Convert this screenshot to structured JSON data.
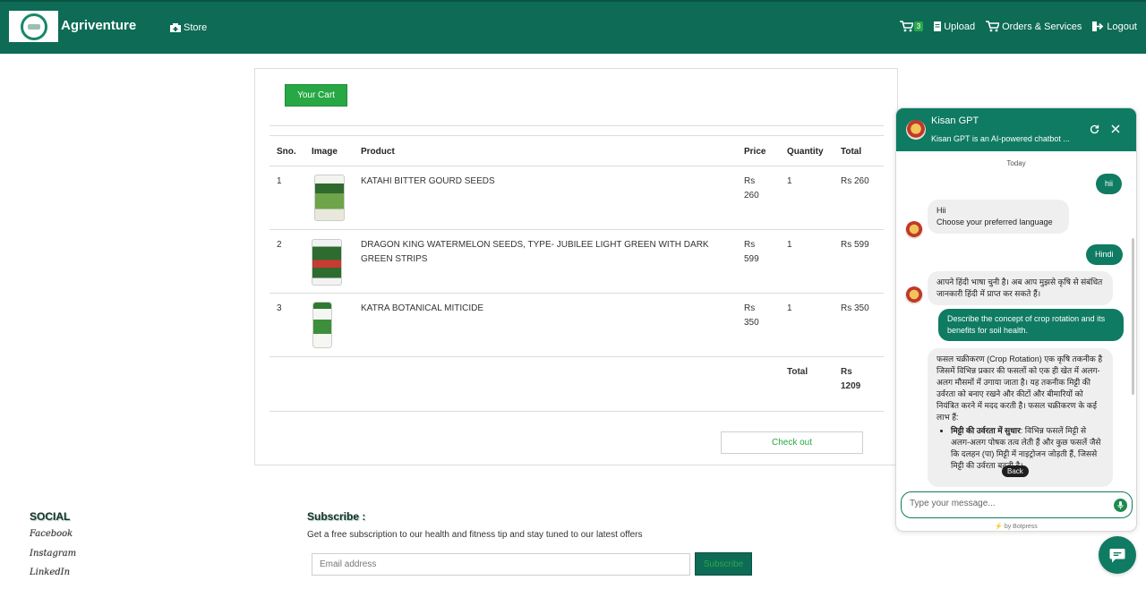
{
  "navbar": {
    "brand": "Agriventure",
    "store": "Store",
    "cart_count": "3",
    "upload": "Upload",
    "orders": "Orders & Services",
    "logout": "Logout"
  },
  "cart": {
    "title": "Your Cart",
    "headers": {
      "sno": "Sno.",
      "image": "Image",
      "product": "Product",
      "price": "Price",
      "quantity": "Quantity",
      "total": "Total"
    },
    "rows": [
      {
        "sno": "1",
        "product_line1": "KATAHI BITTER GOURD SEEDS",
        "product_line2": "",
        "price_line1": "Rs",
        "price_line2": "260",
        "quantity": "1",
        "total": "Rs 260"
      },
      {
        "sno": "2",
        "product_line1": "DRAGON KING WATERMELON SEEDS, TYPE- JUBILEE LIGHT GREEN WITH DARK",
        "product_line2": "GREEN STRIPS",
        "price_line1": "Rs",
        "price_line2": "599",
        "quantity": "1",
        "total": "Rs 599"
      },
      {
        "sno": "3",
        "product_line1": "KATRA BOTANICAL MITICIDE",
        "product_line2": "",
        "price_line1": "Rs",
        "price_line2": "350",
        "quantity": "1",
        "total": "Rs 350"
      }
    ],
    "grand_total_label": "Total",
    "grand_total_line1": "Rs",
    "grand_total_line2": "1209",
    "checkout": "Check out"
  },
  "footer": {
    "social_title": "SOCIAL",
    "links": [
      "Facebook",
      "Instagram",
      "LinkedIn"
    ],
    "subscribe_title": "Subscribe :",
    "subscribe_desc": "Get a free subscription to our health and fitness tip and stay tuned to our latest offers",
    "email_placeholder": "Email address",
    "subscribe_button": "Subscribe"
  },
  "chat": {
    "title": "Kisan GPT",
    "subtitle": "Kisan GPT is an AI-powered chatbot ...",
    "date_divider": "Today",
    "msg_user_1": "hii",
    "msg_bot_1_line1": "Hii",
    "msg_bot_1_line2": "Choose your preferred language",
    "msg_user_2": "Hindi",
    "msg_bot_2": "आपने हिंदी भाषा चुनी है। अब आप मुझसे कृषि से संबंधित जानकारी हिंदी में प्राप्त कर सकते हैं।",
    "msg_user_3": "Describe the concept of crop rotation and its benefits for soil health.",
    "msg_bot_3_intro": "फसल चक्रीकरण (Crop Rotation) एक कृषि तकनीक है जिसमें विभिन्न प्रकार की फसलों को एक ही खेत में अलग-अलग मौसमों में उगाया जाता है। यह तकनीक मिट्टी की उर्वरता को बनाए रखने और कीटों और बीमारियों को नियंत्रित करने में मदद करती है। फसल चक्रीकरण के कई लाभ हैं:",
    "msg_bot_3_point_title": "मिट्टी की उर्वरता में सुधार",
    "msg_bot_3_point_body": ": विभिन्न फसलें मिट्टी से अलग-अलग पोषक तत्व लेती हैं और कुछ फसलें जैसे कि दलहन (पा) मिट्टी में नाइट्रोजन जोड़ती हैं, जिससे मिट्टी की उर्वरता बढ़ती है।",
    "back_label": "Back",
    "input_placeholder": "Type your message...",
    "powered_by": "by Botpress"
  }
}
